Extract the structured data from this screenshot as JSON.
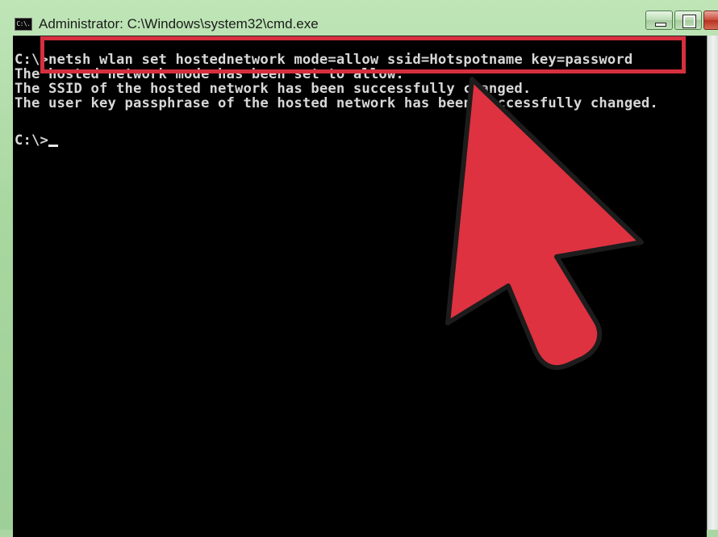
{
  "window": {
    "title": "Administrator: C:\\Windows\\system32\\cmd.exe",
    "icon_label": "C:\\."
  },
  "console": {
    "lines": [
      "C:\\>netsh wlan set hostednetwork mode=allow ssid=Hotspotname key=password",
      "The hosted network mode has been set to allow.",
      "The SSID of the hosted network has been successfully changed.",
      "The user key passphrase of the hosted network has been successfully changed."
    ],
    "prompt": "C:\\>"
  },
  "annotation": {
    "color": "#d62f3d",
    "icon": "pointer-arrow-icon"
  }
}
